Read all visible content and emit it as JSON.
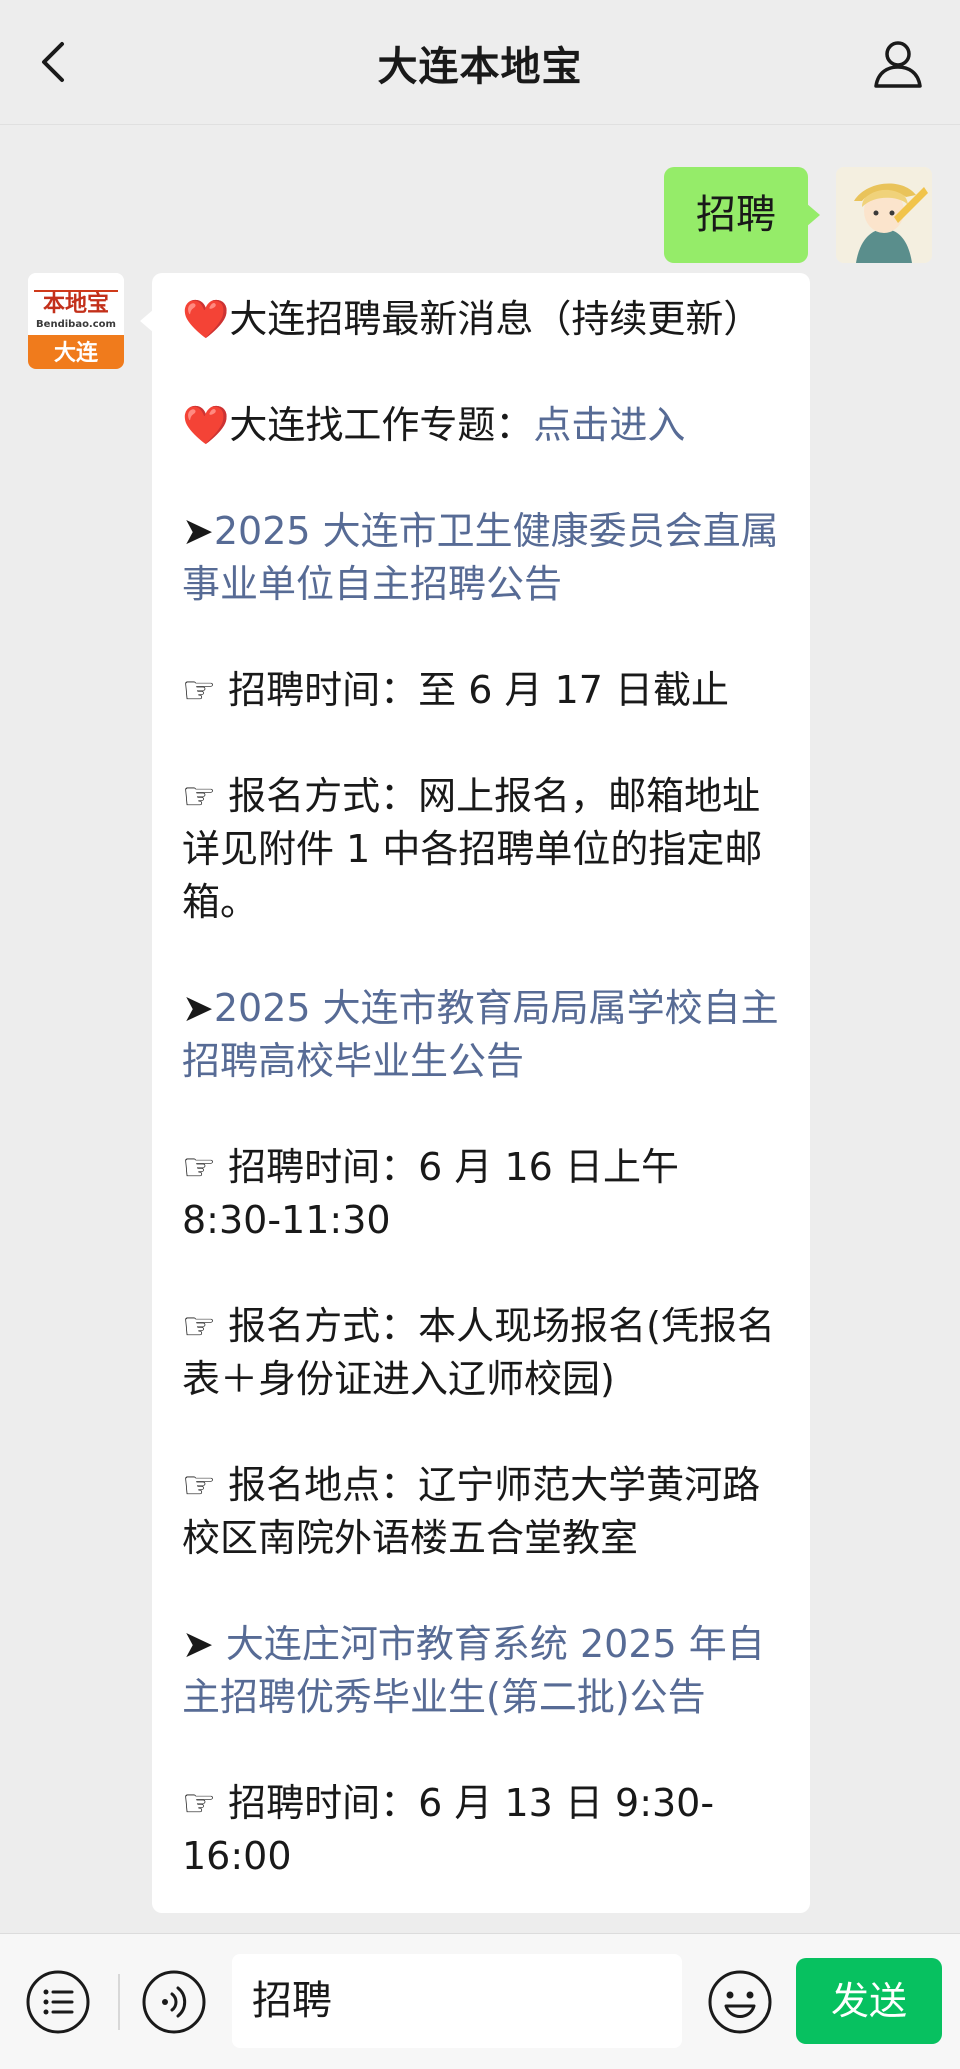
{
  "header": {
    "title": "大连本地宝"
  },
  "chat": {
    "my_message": "招聘",
    "bot_logo": {
      "top": "本地宝",
      "site": "Bendibao.com",
      "city": "大连"
    },
    "bot_message": {
      "p1_icon": "❤️",
      "p1_text": "大连招聘最新消息（持续更新）",
      "p2_icon": "❤️",
      "p2_text": "大连找工作专题：",
      "p2_link": "点击进入",
      "p3_arrow": "➤",
      "p3_link": "2025 大连市卫生健康委员会直属事业单位自主招聘公告",
      "p4_icon": "☞",
      "p4_text": "招聘时间：至 6 月 17 日截止",
      "p5_icon": "☞",
      "p5_text": "报名方式：网上报名，邮箱地址详见附件 1 中各招聘单位的指定邮箱。",
      "p6_arrow": "➤",
      "p6_link": "2025 大连市教育局局属学校自主招聘高校毕业生公告",
      "p7_icon": "☞",
      "p7_text": "招聘时间：6 月 16 日上午 8:30-11:30",
      "p8_icon": "☞",
      "p8_text": "报名方式：本人现场报名(凭报名表＋身份证进入辽师校园)",
      "p9_icon": "☞",
      "p9_text": "报名地点：辽宁师范大学黄河路校区南院外语楼五合堂教室",
      "p10_arrow": "➤ ",
      "p10_link": "大连庄河市教育系统 2025 年自主招聘优秀毕业生(第二批)公告",
      "p11_icon": "☞",
      "p11_text": "招聘时间：6 月 13 日 9:30-16:00"
    }
  },
  "bottom_bar": {
    "input_value": "招聘",
    "send_label": "发送"
  },
  "colors": {
    "link": "#576b95",
    "my_bubble": "#95ec69",
    "send_button": "#07c160",
    "background": "#ededed"
  }
}
